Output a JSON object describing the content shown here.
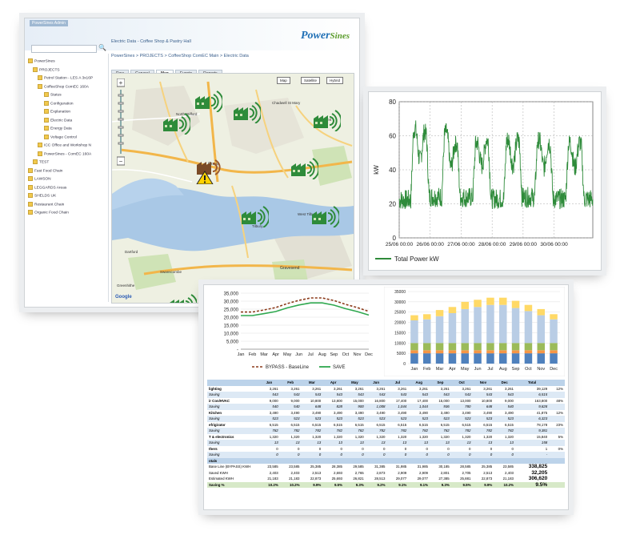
{
  "window1": {
    "app_title": "PowerSines Admin",
    "logo": {
      "power": "Power",
      "sines": "Sines"
    },
    "page_title": "Electric Data - Coffee Shop & Pastry Hall",
    "breadcrumb": "PowerSines > PROJECTS > CoffeeShop ComEC Main > Electric Data",
    "sidebar": {
      "items": [
        {
          "label": "PowerSines"
        },
        {
          "label": "PROJECTS"
        },
        {
          "label": "Petrol Station - LES A 3x16P"
        },
        {
          "label": "CoffeeShop ComEC 160A"
        },
        {
          "label": "Status"
        },
        {
          "label": "Configuration"
        },
        {
          "label": "Explanation"
        },
        {
          "label": "Electric Data"
        },
        {
          "label": "Energy Data"
        },
        {
          "label": "Voltage Control"
        },
        {
          "label": "ICC Office and Workshop N"
        },
        {
          "label": "PowerSines - ComEC 160A"
        },
        {
          "label": "TEST"
        },
        {
          "label": "Fast Food Chain"
        },
        {
          "label": "LAWSON"
        },
        {
          "label": "LEGGARDS Areas"
        },
        {
          "label": "SHELDS UK"
        },
        {
          "label": "Restaurant Chain"
        },
        {
          "label": "Organic Food Chain"
        }
      ]
    },
    "tabs": [
      "Raw",
      "General",
      "Map",
      "Events",
      "Reports"
    ],
    "active_tab": "Map",
    "map": {
      "buttons": [
        "Map",
        "Satellite",
        "Hybrid"
      ],
      "labels": [
        "Gravesend",
        "Swanscombe",
        "Grays",
        "West Tilbury",
        "North Stifford",
        "Chadwell St Mary",
        "Orsett",
        "Tilbury",
        "Dartford",
        "Greenhithe"
      ],
      "google": "Google"
    }
  },
  "window2": {
    "chart_data": {
      "type": "line",
      "title": "",
      "xlabel": "",
      "ylabel": "kW",
      "ylim": [
        0,
        80
      ],
      "yticks": [
        0,
        20,
        40,
        60,
        80
      ],
      "xticks": [
        "25/06 00:00",
        "26/06 00:00",
        "27/06 00:00",
        "28/06 00:00",
        "29/06 00:00",
        "30/06 00:00"
      ],
      "grid": true,
      "legend": "bottom-left",
      "series": [
        {
          "name": "Total Power kW",
          "color": "#2e8b3a",
          "daily_min": [
            20,
            22,
            22,
            21,
            22,
            21
          ],
          "daily_max": [
            67,
            65,
            58,
            60,
            60,
            58
          ]
        }
      ]
    }
  },
  "window3": {
    "line_chart": {
      "chart_data": {
        "type": "line",
        "title": "",
        "categories": [
          "Jan",
          "Feb",
          "Mar",
          "Apr",
          "May",
          "Jun",
          "Jul",
          "Aug",
          "Sep",
          "Oct",
          "Nov",
          "Dec"
        ],
        "ylim": [
          0,
          35000
        ],
        "yticks": [
          "-",
          "5,000",
          "10,000",
          "15,000",
          "20,000",
          "25,000",
          "30,000",
          "35,000"
        ],
        "legend": "bottom",
        "series": [
          {
            "name": "BYPASS - BaseLine",
            "color": "#8b3a1a",
            "dashed": true,
            "values": [
              23185,
              23185,
              24500,
              26000,
              28500,
              30500,
              31985,
              31985,
              30385,
              28000,
              26000,
              23585
            ]
          },
          {
            "name": "SAVE",
            "color": "#2fa84f",
            "dashed": false,
            "values": [
              21000,
              21000,
              22200,
              23500,
              25800,
              27600,
              28900,
              28900,
              27500,
              25300,
              23500,
              21300
            ]
          }
        ]
      }
    },
    "bar_chart": {
      "chart_data": {
        "type": "bar",
        "stacked": true,
        "categories": [
          "Jan",
          "Feb",
          "Mar",
          "Apr",
          "May",
          "Jun",
          "Jul",
          "Aug",
          "Sep",
          "Oct",
          "Nov",
          "Dec"
        ],
        "ylim": [
          0,
          35000
        ],
        "yticks": [
          "0",
          "5000",
          "10000",
          "15000",
          "20000",
          "25000",
          "30000",
          "35000"
        ],
        "series": [
          {
            "name": "",
            "color": "#4f81bd",
            "values": [
              5000,
              5000,
              5000,
              5000,
              5000,
              5000,
              5000,
              5000,
              5000,
              5000,
              5000,
              5000
            ]
          },
          {
            "name": "",
            "color": "#f79646",
            "values": [
              1500,
              1500,
              1500,
              1500,
              1500,
              1500,
              1500,
              1500,
              1500,
              1500,
              1500,
              1500
            ]
          },
          {
            "name": "",
            "color": "#9bbb59",
            "values": [
              3500,
              3500,
              3500,
              3500,
              3500,
              3500,
              3500,
              3500,
              3500,
              3500,
              3500,
              3500
            ]
          },
          {
            "name": "",
            "color": "#b9cde5",
            "values": [
              11000,
              11500,
              13000,
              14500,
              16500,
              17500,
              18500,
              18500,
              17000,
              15500,
              13500,
              11500
            ]
          },
          {
            "name": "",
            "color": "#ffd966",
            "values": [
              2500,
              2500,
              3000,
              3000,
              3500,
              3500,
              3500,
              3500,
              3500,
              3000,
              3000,
              2500
            ]
          }
        ]
      }
    },
    "table": {
      "months": [
        "Jan",
        "Feb",
        "Mar",
        "Apr",
        "May",
        "Jun",
        "Jul",
        "Aug",
        "Sep",
        "Oct",
        "Nov",
        "Dec",
        "Total"
      ],
      "rows": [
        {
          "kind": "cat",
          "label": "lighting",
          "cells": [
            "3,261",
            "3,261",
            "3,261",
            "3,261",
            "3,261",
            "3,261",
            "3,261",
            "3,261",
            "3,261",
            "3,261",
            "3,261",
            "3,261",
            "39,129"
          ],
          "pct": "12%"
        },
        {
          "kind": "sav",
          "label": "Saving",
          "cells": [
            "543",
            "543",
            "543",
            "543",
            "543",
            "543",
            "543",
            "543",
            "543",
            "543",
            "543",
            "543",
            "6,515"
          ],
          "pct": ""
        },
        {
          "kind": "cat",
          "label": "ir Con/HVAC",
          "cells": [
            "9,000",
            "9,000",
            "10,800",
            "13,800",
            "15,000",
            "16,800",
            "17,400",
            "17,400",
            "15,000",
            "13,000",
            "10,800",
            "9,000",
            "163,800"
          ],
          "pct": "48%"
        },
        {
          "kind": "sav",
          "label": "Saving",
          "cells": [
            "540",
            "540",
            "648",
            "828",
            "900",
            "1,008",
            "1,044",
            "1,044",
            "936",
            "780",
            "648",
            "540",
            "9,828"
          ],
          "pct": ""
        },
        {
          "kind": "cat",
          "label": "Kitchen",
          "cells": [
            "3,490",
            "3,490",
            "3,490",
            "3,490",
            "3,490",
            "3,490",
            "3,490",
            "3,490",
            "3,490",
            "3,490",
            "3,490",
            "3,490",
            "41,875"
          ],
          "pct": "12%"
        },
        {
          "kind": "sav",
          "label": "Saving",
          "cells": [
            "523",
            "523",
            "523",
            "523",
            "523",
            "523",
            "523",
            "523",
            "523",
            "523",
            "523",
            "523",
            "6,323"
          ],
          "pct": ""
        },
        {
          "kind": "cat",
          "label": "efrigirator",
          "cells": [
            "6,515",
            "6,515",
            "6,515",
            "6,515",
            "6,515",
            "6,515",
            "6,515",
            "6,515",
            "6,515",
            "6,515",
            "6,515",
            "6,515",
            "78,178"
          ],
          "pct": "23%"
        },
        {
          "kind": "sav",
          "label": "Saving",
          "cells": [
            "782",
            "782",
            "782",
            "782",
            "782",
            "782",
            "782",
            "782",
            "782",
            "782",
            "782",
            "782",
            "9,381"
          ],
          "pct": ""
        },
        {
          "kind": "cat",
          "label": "T & electronics",
          "cells": [
            "1,320",
            "1,320",
            "1,320",
            "1,320",
            "1,320",
            "1,320",
            "1,320",
            "1,320",
            "1,320",
            "1,320",
            "1,320",
            "1,320",
            "15,840"
          ],
          "pct": "5%"
        },
        {
          "kind": "sav",
          "label": "Saving",
          "cells": [
            "13",
            "13",
            "13",
            "13",
            "13",
            "13",
            "13",
            "13",
            "13",
            "13",
            "13",
            "13",
            "158"
          ],
          "pct": ""
        },
        {
          "kind": "cat",
          "label": "thers",
          "cells": [
            "0",
            "0",
            "0",
            "0",
            "0",
            "0",
            "0",
            "0",
            "0",
            "0",
            "0",
            "0",
            "1"
          ],
          "pct": "0%"
        },
        {
          "kind": "sav",
          "label": "Saving",
          "cells": [
            "0",
            "0",
            "0",
            "0",
            "0",
            "0",
            "0",
            "0",
            "0",
            "0",
            "0",
            "0",
            "-"
          ],
          "pct": ""
        },
        {
          "kind": "tot",
          "label": "otals",
          "cells": [
            "",
            "",
            "",
            "",
            "",
            "",
            "",
            "",
            "",
            "",
            "",
            "",
            ""
          ],
          "pct": ""
        },
        {
          "kind": "sum",
          "label": "Base Line (BYPASS) KWH",
          "cells": [
            "23,585",
            "23,585",
            "25,385",
            "28,385",
            "29,585",
            "31,385",
            "31,985",
            "31,985",
            "30,185",
            "28,585",
            "25,385",
            "23,585",
            "338,825"
          ],
          "pct": ""
        },
        {
          "kind": "sum",
          "label": "Saved KWH",
          "cells": [
            "2,403",
            "2,403",
            "2,513",
            "2,693",
            "2,765",
            "2,873",
            "2,909",
            "2,909",
            "2,801",
            "2,705",
            "2,513",
            "2,403",
            "32,205"
          ],
          "pct": ""
        },
        {
          "kind": "sum",
          "label": "Estimated KWH",
          "cells": [
            "21,183",
            "21,183",
            "22,873",
            "25,693",
            "26,821",
            "28,513",
            "29,077",
            "29,077",
            "27,385",
            "25,881",
            "22,873",
            "21,183",
            "306,620"
          ],
          "pct": ""
        },
        {
          "kind": "pct",
          "label": "Saving %",
          "cells": [
            "10.2%",
            "10.2%",
            "9.9%",
            "9.5%",
            "9.3%",
            "9.2%",
            "9.1%",
            "9.1%",
            "9.3%",
            "9.5%",
            "9.9%",
            "10.2%",
            "9.5%"
          ],
          "pct": ""
        }
      ]
    }
  }
}
